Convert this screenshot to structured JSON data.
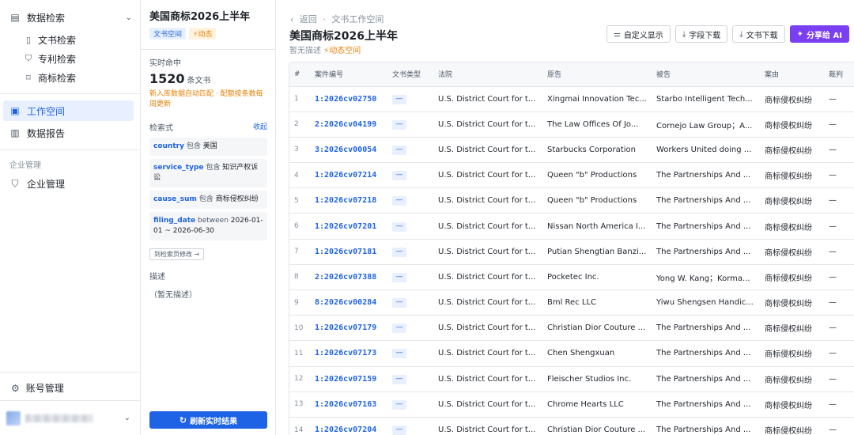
{
  "sidebar": {
    "group_title": "数据检索",
    "sub_items": [
      {
        "label": "文书检索",
        "icon": "document-icon"
      },
      {
        "label": "专利检索",
        "icon": "shield-icon"
      },
      {
        "label": "商标检索",
        "icon": "bookmark-icon"
      }
    ],
    "workspace_label": "工作空间",
    "reports_label": "数据报告",
    "enterprise_section": "企业管理",
    "enterprise_label": "企业管理",
    "account_label": "账号管理"
  },
  "panel": {
    "title": "美国商标2026上半年",
    "tag_workspace": "文书空间",
    "tag_dynamic": "⚡动态",
    "hits_label": "实时命中",
    "hits_count": "1520",
    "hits_unit": "条文书",
    "hits_note": "新入库数据自动匹配 · 配额按条数每周更新",
    "expr_label": "检索式",
    "fold_label": "收起",
    "expressions": [
      {
        "field": "country",
        "op": "包含",
        "value": "美国"
      },
      {
        "field": "service_type",
        "op": "包含",
        "value": "知识产权诉讼"
      },
      {
        "field": "cause_sum",
        "op": "包含",
        "value": "商标侵权纠纷"
      },
      {
        "field": "filing_date",
        "op": "between",
        "value": "2026-01-01 ~ 2026-06-30"
      }
    ],
    "modify_button": "到检索页修改 →",
    "desc_label": "描述",
    "desc_text": "（暂无描述）",
    "refresh_button": "刷新实时结果"
  },
  "main": {
    "back_label": "返回",
    "breadcrumb_sep": "·",
    "breadcrumb_page": "文书工作空间",
    "title": "美国商标2026上半年",
    "no_desc": "暂无描述",
    "dynamic": "⚡动态空间",
    "toolbar": {
      "custom_display": "自定义显示",
      "field_download": "字段下载",
      "doc_download": "文书下载",
      "share_ai": "分享给 AI"
    },
    "columns": [
      "#",
      "案件编号",
      "文书类型",
      "法院",
      "原告",
      "被告",
      "案由",
      "裁判"
    ],
    "rows": [
      {
        "idx": "1",
        "case": "1:2026cv02750",
        "type": "—",
        "court": "U.S. District Court for t...",
        "plaintiff": "Xingmai Innovation Tec...",
        "defendant": "Starbo Intelligent Tech...",
        "cause": "商标侵权纠纷",
        "judge": "—"
      },
      {
        "idx": "2",
        "case": "2:2026cv04199",
        "type": "—",
        "court": "U.S. District Court for t...",
        "plaintiff": "The Law Offices Of Jo...",
        "defendant": "Cornejo Law Group；A...",
        "cause": "商标侵权纠纷",
        "judge": "—"
      },
      {
        "idx": "3",
        "case": "3:2026cv00054",
        "type": "—",
        "court": "U.S. District Court for t...",
        "plaintiff": "Starbucks Corporation",
        "defendant": "Workers United doing ...",
        "cause": "商标侵权纠纷",
        "judge": "—"
      },
      {
        "idx": "4",
        "case": "1:2026cv07214",
        "type": "—",
        "court": "U.S. District Court for t...",
        "plaintiff": "Queen \"b\" Productions",
        "defendant": "The Partnerships And ...",
        "cause": "商标侵权纠纷",
        "judge": "—"
      },
      {
        "idx": "5",
        "case": "1:2026cv07218",
        "type": "—",
        "court": "U.S. District Court for t...",
        "plaintiff": "Queen \"b\" Productions",
        "defendant": "The Partnerships And ...",
        "cause": "商标侵权纠纷",
        "judge": "—"
      },
      {
        "idx": "6",
        "case": "1:2026cv07201",
        "type": "—",
        "court": "U.S. District Court for t...",
        "plaintiff": "Nissan North America I...",
        "defendant": "The Partnerships And ...",
        "cause": "商标侵权纠纷",
        "judge": "—"
      },
      {
        "idx": "7",
        "case": "1:2026cv07181",
        "type": "—",
        "court": "U.S. District Court for t...",
        "plaintiff": "Putian Shengtian Banzi...",
        "defendant": "The Partnerships And ...",
        "cause": "商标侵权纠纷",
        "judge": "—"
      },
      {
        "idx": "8",
        "case": "2:2026cv07388",
        "type": "—",
        "court": "U.S. District Court for t...",
        "plaintiff": "Pocketec Inc.",
        "defendant": "Yong W. Kang；Korma...",
        "cause": "商标侵权纠纷",
        "judge": "—"
      },
      {
        "idx": "9",
        "case": "8:2026cv00284",
        "type": "—",
        "court": "U.S. District Court for t...",
        "plaintiff": "Bml Rec LLC",
        "defendant": "Yiwu Shengsen Handic...",
        "cause": "商标侵权纠纷",
        "judge": "—"
      },
      {
        "idx": "10",
        "case": "1:2026cv07179",
        "type": "—",
        "court": "U.S. District Court for t...",
        "plaintiff": "Christian Dior Couture ...",
        "defendant": "The Partnerships And ...",
        "cause": "商标侵权纠纷",
        "judge": "—"
      },
      {
        "idx": "11",
        "case": "1:2026cv07173",
        "type": "—",
        "court": "U.S. District Court for t...",
        "plaintiff": "Chen Shengxuan",
        "defendant": "The Partnerships And ...",
        "cause": "商标侵权纠纷",
        "judge": "—"
      },
      {
        "idx": "12",
        "case": "1:2026cv07159",
        "type": "—",
        "court": "U.S. District Court for t...",
        "plaintiff": "Fleischer Studios Inc.",
        "defendant": "The Partnerships And ...",
        "cause": "商标侵权纠纷",
        "judge": "—"
      },
      {
        "idx": "13",
        "case": "1:2026cv07163",
        "type": "—",
        "court": "U.S. District Court for t...",
        "plaintiff": "Chrome Hearts LLC",
        "defendant": "The Partnerships And ...",
        "cause": "商标侵权纠纷",
        "judge": "—"
      },
      {
        "idx": "14",
        "case": "1:2026cv07204",
        "type": "—",
        "court": "U.S. District Court for t...",
        "plaintiff": "Christian Dior Couture ...",
        "defendant": "The Partnerships And ...",
        "cause": "商标侵权纠纷",
        "judge": "—"
      }
    ]
  },
  "colors": {
    "accent": "#1e63e5",
    "ai_button": "#7b3ff2",
    "dynamic": "#e6820a"
  }
}
